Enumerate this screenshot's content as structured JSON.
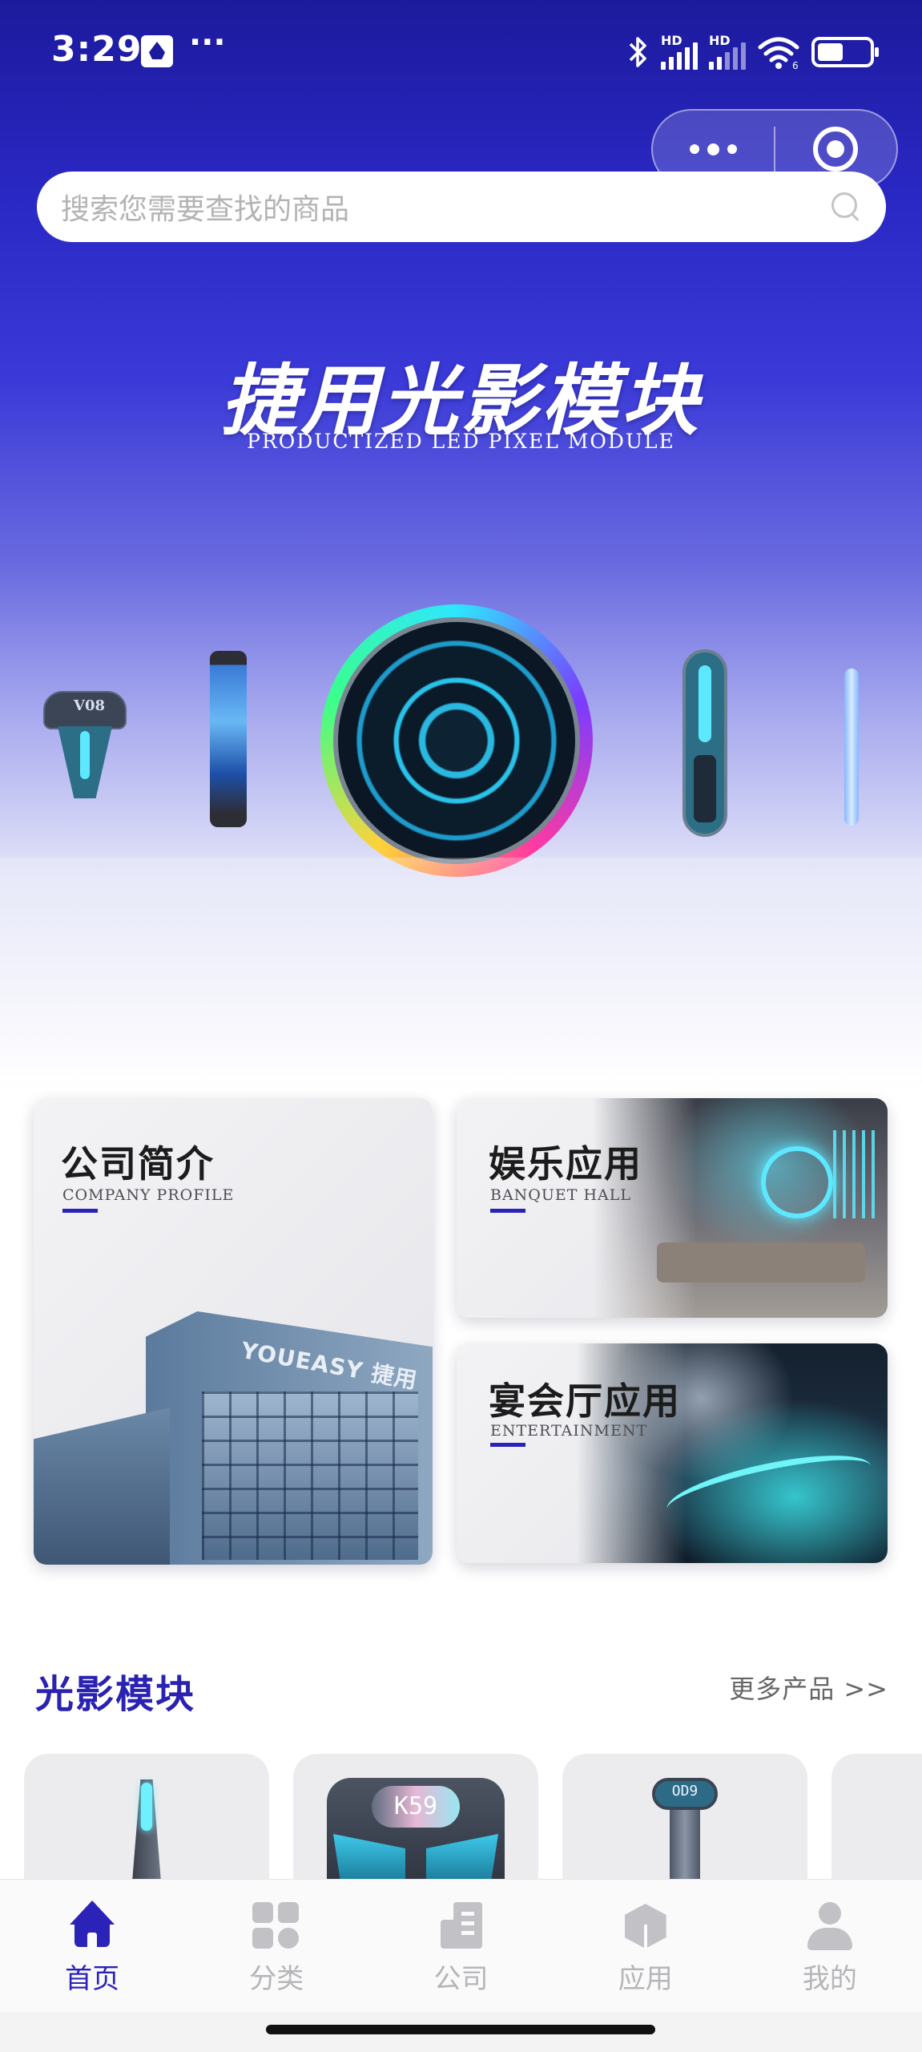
{
  "status_bar": {
    "time": "3:29",
    "more": "···",
    "network_1": "HD",
    "network_2": "HD",
    "wifi_badge": "6",
    "battery_level": 0.5
  },
  "search": {
    "placeholder": "搜索您需要查找的商品"
  },
  "hero": {
    "title": "捷用光影模块",
    "subtitle": "PRODUCTIZED LED PIXEL MODULE",
    "product_labels": {
      "v08": "V08"
    }
  },
  "cards": {
    "company": {
      "title": "公司简介",
      "subtitle": "COMPANY PROFILE",
      "sign": "YOUEASY 捷用"
    },
    "entertainment": {
      "title": "娱乐应用",
      "subtitle": "BANQUET HALL"
    },
    "banquet": {
      "title": "宴会厅应用",
      "subtitle": "ENTERTAINMENT"
    }
  },
  "section": {
    "title": "光影模块",
    "more": "更多产品 >>"
  },
  "products": [
    {
      "label": ""
    },
    {
      "label": "K59"
    },
    {
      "label": "OD9"
    }
  ],
  "tabbar": {
    "items": [
      {
        "label": "首页",
        "icon": "home-icon",
        "active": true
      },
      {
        "label": "分类",
        "icon": "category-icon",
        "active": false
      },
      {
        "label": "公司",
        "icon": "company-icon",
        "active": false
      },
      {
        "label": "应用",
        "icon": "application-icon",
        "active": false
      },
      {
        "label": "我的",
        "icon": "profile-icon",
        "active": false
      }
    ]
  },
  "colors": {
    "brand": "#2b22b8",
    "hero_top": "#1c1a9c",
    "tab_inactive": "#b5b5b9"
  }
}
